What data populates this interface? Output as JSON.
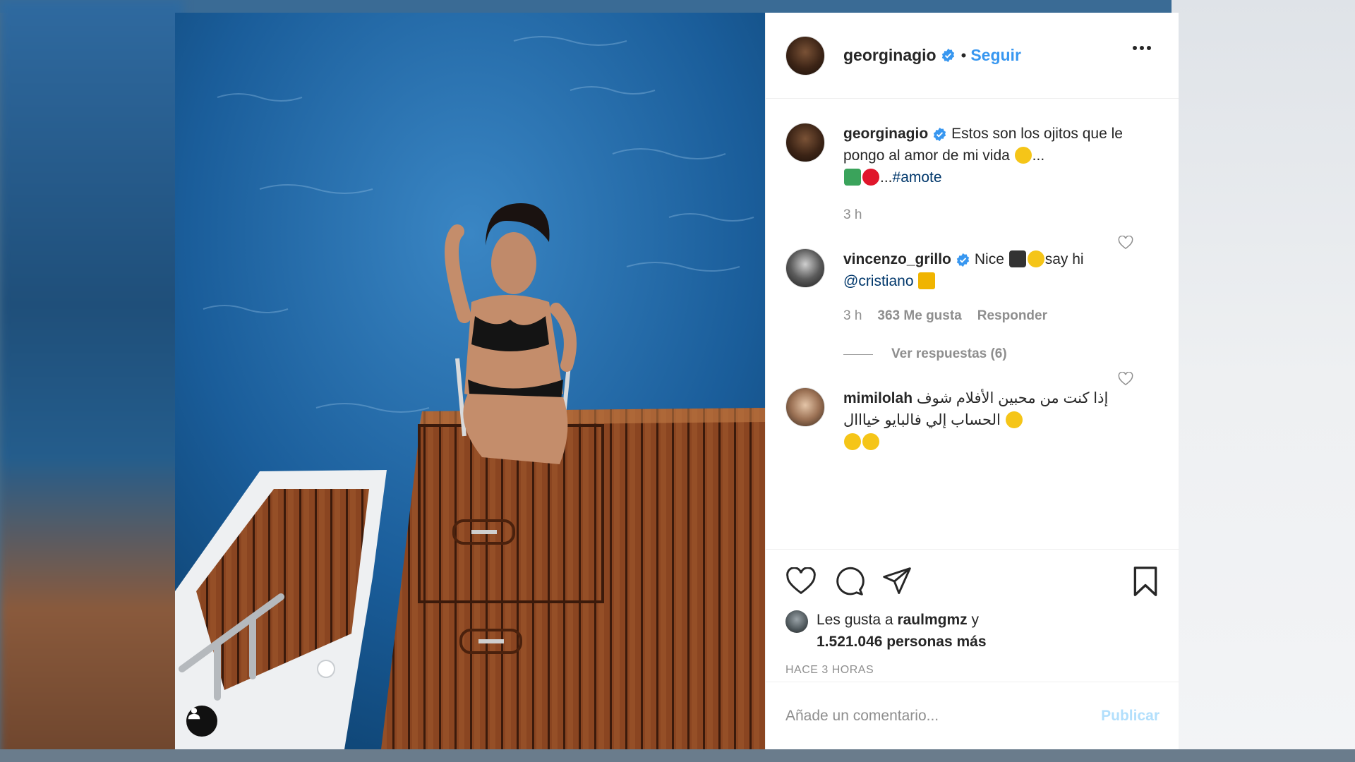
{
  "post": {
    "username": "georginagio",
    "follow_label": "Seguir",
    "separator": "•"
  },
  "caption": {
    "username": "georginagio",
    "text": "Estos son los ojitos que le pongo al amor de mi vida",
    "ellipsis": "...",
    "hashtag": "#amote",
    "time": "3 h"
  },
  "comments": [
    {
      "username": "vincenzo_grillo",
      "text_1": "Nice",
      "text_2": "say hi",
      "mention": "@cristiano",
      "time": "3 h",
      "likes": "363 Me gusta",
      "reply_label": "Responder",
      "view_replies": "Ver respuestas (6)"
    },
    {
      "username": "mimilolah",
      "text": "إذا كنت من محبين الأفلام شوف الحساب إلي فالبايو خيااال"
    }
  ],
  "likes": {
    "prefix": "Les gusta a",
    "user": "raulmgmz",
    "joiner": "y",
    "count_text": "1.521.046 personas más"
  },
  "time_ago": "HACE 3 HORAS",
  "comment_input": {
    "placeholder": "Añade un comentario...",
    "publish_label": "Publicar"
  },
  "colors": {
    "link": "#3897f0",
    "verified": "#3897f0",
    "text": "#262626",
    "muted": "#8e8e8e"
  }
}
